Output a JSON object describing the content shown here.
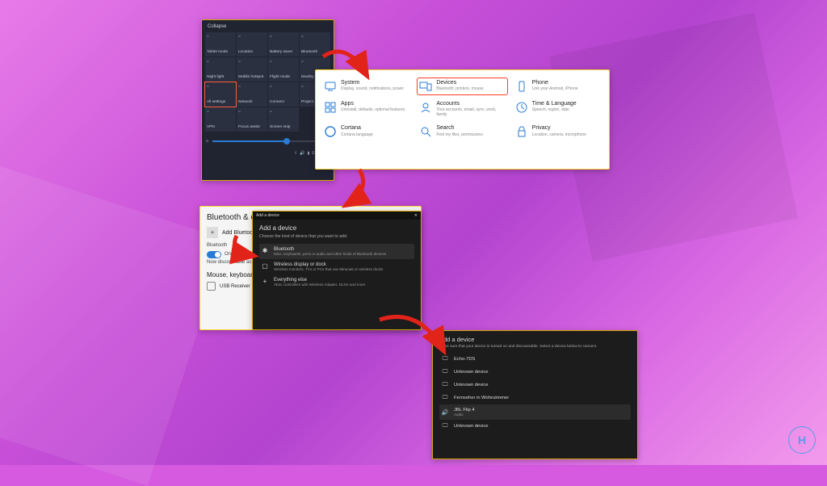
{
  "action_center": {
    "collapse": "Collapse",
    "tiles": [
      {
        "label": "Tablet mode"
      },
      {
        "label": "Location"
      },
      {
        "label": "Battery saver"
      },
      {
        "label": "Bluetooth"
      },
      {
        "label": "Night light"
      },
      {
        "label": "Mobile hotspot"
      },
      {
        "label": "Flight mode"
      },
      {
        "label": "Nearby sharing"
      },
      {
        "label": "All settings",
        "sel": true
      },
      {
        "label": "Network"
      },
      {
        "label": "Connect"
      },
      {
        "label": "Project"
      },
      {
        "label": "VPN"
      },
      {
        "label": "Focus assist"
      },
      {
        "label": "Screen snip"
      }
    ],
    "brightness_pct": 60,
    "tray": {
      "lang": "ENG"
    }
  },
  "settings": {
    "items": [
      {
        "t": "System",
        "d": "Display, sound, notifications, power",
        "ico": "monitor"
      },
      {
        "t": "Devices",
        "d": "Bluetooth, printers, mouse",
        "ico": "devices",
        "sel": true
      },
      {
        "t": "Phone",
        "d": "Link your Android, iPhone",
        "ico": "phone"
      },
      {
        "t": "Apps",
        "d": "Uninstall, defaults, optional features",
        "ico": "apps"
      },
      {
        "t": "Accounts",
        "d": "Your accounts, email, sync, work, family",
        "ico": "account"
      },
      {
        "t": "Time & Language",
        "d": "Speech, region, date",
        "ico": "time"
      },
      {
        "t": "Cortana",
        "d": "Cortana language",
        "ico": "cortana"
      },
      {
        "t": "Search",
        "d": "Find my files, permissions",
        "ico": "search"
      },
      {
        "t": "Privacy",
        "d": "Location, camera, microphone",
        "ico": "privacy"
      }
    ]
  },
  "bt": {
    "heading": "Bluetooth & other devices",
    "add": "Add Bluetooth or other device",
    "label": "Bluetooth",
    "state": "On",
    "discover": "Now discoverable as \"DESKTOP\"",
    "section": "Mouse, keyboard & pen",
    "device": "USB Receiver"
  },
  "add": {
    "bar": "Add a device",
    "title": "Add a device",
    "sub": "Choose the kind of device that you want to add.",
    "opts": [
      {
        "t": "Bluetooth",
        "d": "Mice, keyboards, pens or audio and other kinds of Bluetooth devices",
        "ico": "✱",
        "sel": true
      },
      {
        "t": "Wireless display or dock",
        "d": "Wireless monitors, TVs or PCs that use Miracast or wireless docks",
        "ico": "▢"
      },
      {
        "t": "Everything else",
        "d": "Xbox controllers with Wireless Adapter, DLNA and more",
        "ico": "+"
      }
    ]
  },
  "devlist": {
    "title": "Add a device",
    "sub": "Make sure that your device is turned on and discoverable. Select a device below to connect.",
    "items": [
      {
        "t": "Echo-7DS",
        "ico": "🖵"
      },
      {
        "t": "Unknown device",
        "ico": "🖵"
      },
      {
        "t": "Unknown device",
        "ico": "🖵"
      },
      {
        "t": "Fernseher in Wohnzimmer",
        "ico": "🖵"
      },
      {
        "t": "JBL Flip 4",
        "d": "Audio",
        "ico": "🔊",
        "sel": true
      },
      {
        "t": "Unknown device",
        "ico": "🖵"
      }
    ]
  }
}
